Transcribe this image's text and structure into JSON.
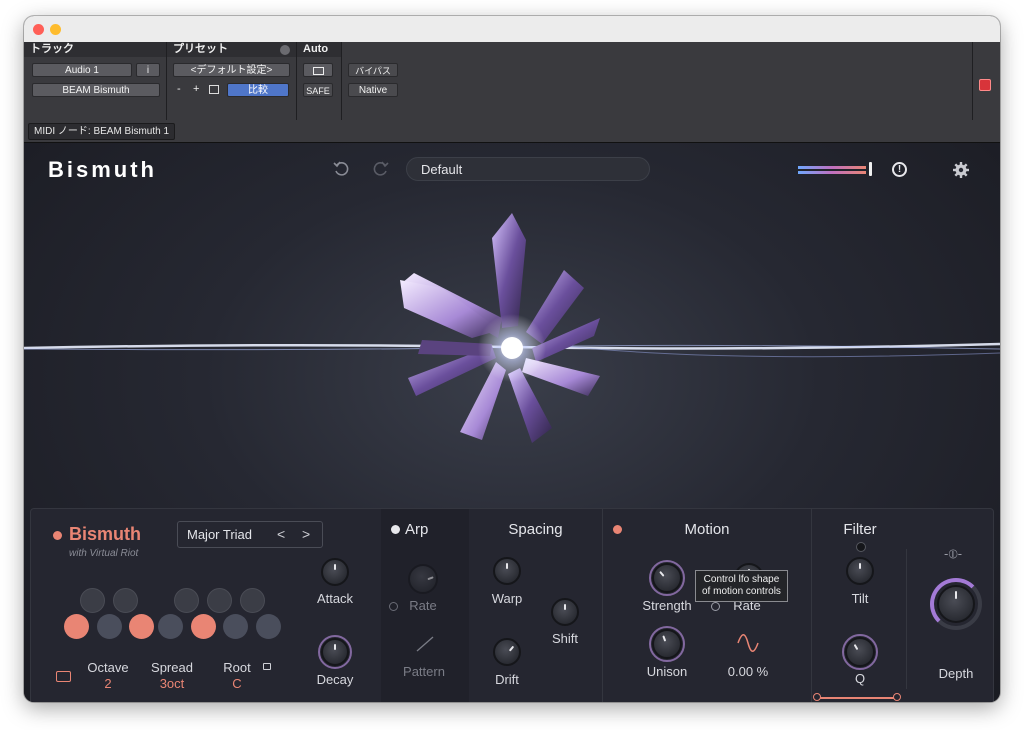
{
  "host": {
    "track_header": "トラック",
    "preset_header": "プリセット",
    "auto_header": "Auto",
    "track_name": "Audio 1",
    "track_i": "i",
    "insert_name": "BEAM Bismuth",
    "preset_name": "<デフォルト設定>",
    "minus": "-",
    "plus": "+",
    "compare": "比較",
    "safe": "SAFE",
    "bypass": "バイパス",
    "native": "Native",
    "midi_node": "MIDI ノード: BEAM Bismuth 1"
  },
  "plugin": {
    "brand": "Bismuth",
    "preset": "Default"
  },
  "chord": {
    "title": "Bismuth",
    "subtitle": "with Virtual Riot",
    "chord_name": "Major Triad",
    "prev": "<",
    "next": ">",
    "octave_label": "Octave",
    "octave_value": "2",
    "spread_label": "Spread",
    "spread_value": "3oct",
    "root_label": "Root",
    "root_value": "C"
  },
  "envelope": {
    "attack": "Attack",
    "decay": "Decay"
  },
  "arp": {
    "header": "Arp",
    "rate": "Rate",
    "pattern": "Pattern"
  },
  "spacing": {
    "header": "Spacing",
    "warp": "Warp",
    "shift": "Shift",
    "drift": "Drift"
  },
  "motion": {
    "header": "Motion",
    "strength": "Strength",
    "rate": "Rate",
    "unison": "Unison",
    "value": "0.00 %",
    "tooltip_line1": "Control lfo shape",
    "tooltip_line2": "of motion controls"
  },
  "filter": {
    "header": "Filter",
    "tilt": "Tilt",
    "q": "Q",
    "depth": "Depth"
  },
  "colors": {
    "accent": "#e98574",
    "brand_text": "#ffffff",
    "panel": "#252630"
  }
}
